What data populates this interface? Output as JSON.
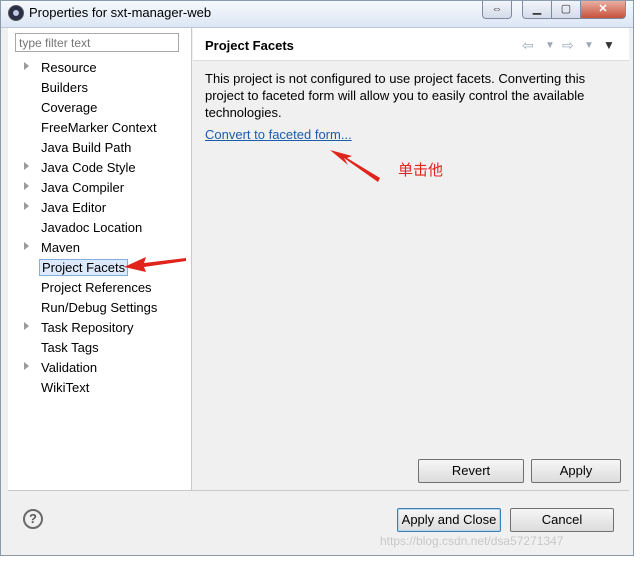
{
  "window": {
    "title": "Properties for sxt-manager-web"
  },
  "filter": {
    "placeholder": "type filter text"
  },
  "tree": [
    {
      "label": "Resource",
      "expandable": true
    },
    {
      "label": "Builders",
      "expandable": false
    },
    {
      "label": "Coverage",
      "expandable": false
    },
    {
      "label": "FreeMarker Context",
      "expandable": false
    },
    {
      "label": "Java Build Path",
      "expandable": false
    },
    {
      "label": "Java Code Style",
      "expandable": true
    },
    {
      "label": "Java Compiler",
      "expandable": true
    },
    {
      "label": "Java Editor",
      "expandable": true
    },
    {
      "label": "Javadoc Location",
      "expandable": false
    },
    {
      "label": "Maven",
      "expandable": true
    },
    {
      "label": "Project Facets",
      "expandable": false,
      "selected": true
    },
    {
      "label": "Project References",
      "expandable": false
    },
    {
      "label": "Run/Debug Settings",
      "expandable": false
    },
    {
      "label": "Task Repository",
      "expandable": true
    },
    {
      "label": "Task Tags",
      "expandable": false
    },
    {
      "label": "Validation",
      "expandable": true
    },
    {
      "label": "WikiText",
      "expandable": false
    }
  ],
  "page": {
    "title": "Project Facets",
    "description": "This project is not configured to use project facets. Converting this project to faceted form will allow you to easily control the available technologies.",
    "link": "Convert to faceted form...",
    "annotation": "单击他"
  },
  "buttons": {
    "revert": "Revert",
    "apply": "Apply",
    "apply_close": "Apply and Close",
    "cancel": "Cancel",
    "help": "?"
  },
  "watermark": "https://blog.csdn.net/dsa57271347",
  "colors": {
    "annotation_arrow": "#e0241c",
    "link": "#1a5dad",
    "selection": "#dceafb"
  }
}
